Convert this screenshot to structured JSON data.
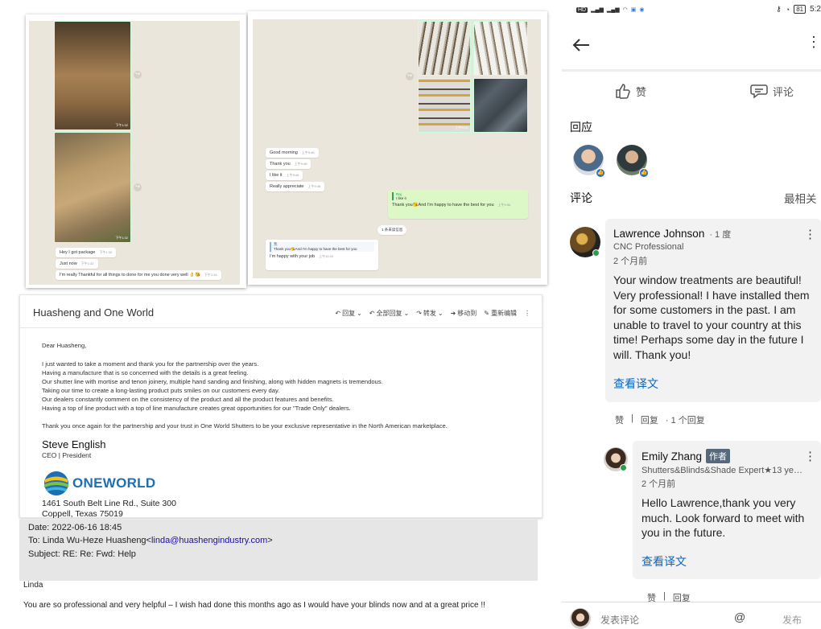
{
  "chat_left": {
    "photo1_time": "下午1:32",
    "photo2_time": "下午1:32",
    "messages": [
      {
        "text": "Hey I got package",
        "time": "下午1:32"
      },
      {
        "text": "Just now",
        "time": "下午1:32"
      },
      {
        "text": "I'm really Thankful for all things to done for me you done very well 👌😘",
        "time": "下午1:34"
      }
    ]
  },
  "chat_right": {
    "photo_time": "上午9:15",
    "messages": [
      {
        "text": "Good morning",
        "time": "上午9:46"
      },
      {
        "text": "Thank you",
        "time": "上午9:46"
      },
      {
        "text": "I like it",
        "time": "上午9:46"
      },
      {
        "text": "Really appreciate",
        "time": "上午9:46"
      }
    ],
    "green_quote_name": "Raj",
    "green_quote_text": "I like it",
    "green_text": "Thank you😘And I'm happy to have the best for you",
    "green_time": "上午9:56",
    "unread_notice": "1 条未读信息",
    "reply_quote_name": "我",
    "reply_quote_text": "Thank you😘And I'm happy to have the best for you",
    "reply_text": "I'm happy with your job",
    "reply_time": "上午10:20"
  },
  "email": {
    "subject": "Huasheng and One World",
    "toolbar": {
      "reply": "回复",
      "reply_all": "全部回复",
      "forward": "转发",
      "move": "移动到",
      "reedit": "重新编辑"
    },
    "greeting": "Dear Huasheng,",
    "lines": [
      "I just wanted to take a moment and thank you for the partnership over the years.",
      "Having a manufacture that is so concerned with the details is a great feeling.",
      "Our shutter line with mortise and tenon joinery, multiple hand sanding and finishing, along with hidden magnets is tremendous.",
      "Taking our time to create a long-lasting product puts smiles on our customers every day.",
      "Our dealers constantly comment on the consistency of the product and all the product features and benefits.",
      "Having a top of line product with a top of line manufacture creates great opportunities for our \"Trade Only\" dealers."
    ],
    "closing": "Thank you once again for the partnership and your trust in One World Shutters to be your exclusive representative in the North American marketplace.",
    "sig_name": "Steve English",
    "sig_title": "CEO | President",
    "logo_text": "ONEWORLD",
    "address1": "1461 South Belt Line Rd., Suite 300",
    "address2": "Coppell, Texas 75019"
  },
  "reply_header": {
    "date": "Date: 2022-06-16 18:45",
    "to_prefix": "To: Linda Wu-Heze Huasheng<",
    "to_email": "linda@huashengindustry.com",
    "to_suffix": ">",
    "subject": "Subject: RE: Re: Fwd: Help",
    "salutation": "Linda",
    "body": "You are so professional and very helpful – I wish  had done this months ago as I would have your blinds now  and at a great price !!"
  },
  "phone": {
    "battery": "81",
    "time": "5:2",
    "like_label": "赞",
    "comment_label": "评论",
    "reactions_title": "回应",
    "comments_title": "评论",
    "sort_label": "最相关",
    "comment1": {
      "name": "Lawrence Johnson",
      "degree": "· 1 度",
      "headline": "CNC Professional",
      "time": "2 个月前",
      "text": "Your window treatments are beautiful! Very professional! I have installed them for some customers in the past. I am unable to travel to your country at this time! Perhaps some day in the future I will. Thank you!",
      "translate": "查看译文",
      "actions": {
        "like": "赞",
        "reply": "回复",
        "replies": "· 1 个回复"
      }
    },
    "comment2": {
      "name": "Emily Zhang",
      "badge": "作者",
      "headline": "Shutters&Blinds&Shade Expert★13 ye…",
      "time": "2 个月前",
      "text": "Hello Lawrence,thank you very much. Look forward to meet with you in the future.",
      "translate": "查看译文",
      "actions": {
        "like": "赞",
        "reply": "回复"
      }
    },
    "input_placeholder": "发表评论",
    "send_label": "发布"
  }
}
